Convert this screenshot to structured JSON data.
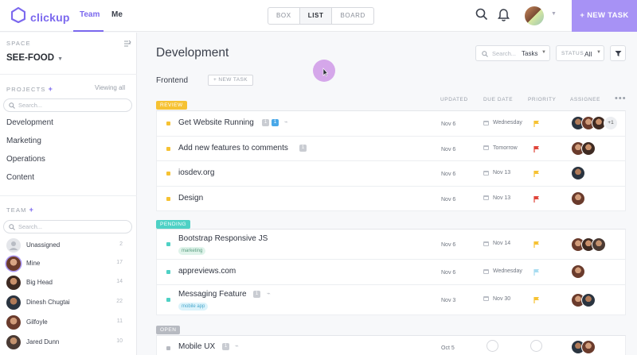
{
  "app": {
    "logo_text": "clickup",
    "brand_color": "#7b68ee"
  },
  "nav": {
    "team": "Team",
    "me": "Me"
  },
  "views": [
    "BOX",
    "LIST",
    "BOARD"
  ],
  "header": {
    "new_task": "+ NEW TASK"
  },
  "sidebar": {
    "space_label": "SPACE",
    "space_name": "SEE-FOOD",
    "projects_label": "PROJECTS",
    "viewing_all": "Viewing all",
    "search_placeholder": "Search...",
    "projects": [
      "Development",
      "Marketing",
      "Operations",
      "Content"
    ],
    "team_label": "TEAM",
    "team_search_placeholder": "Search...",
    "team": [
      {
        "name": "Unassigned",
        "count": "2"
      },
      {
        "name": "Mine",
        "count": "17"
      },
      {
        "name": "Big Head",
        "count": "14"
      },
      {
        "name": "Dinesh Chugtai",
        "count": "22"
      },
      {
        "name": "Gilfoyle",
        "count": "11"
      },
      {
        "name": "Jared Dunn",
        "count": "10"
      }
    ]
  },
  "main": {
    "title": "Development",
    "search_placeholder": "Search...",
    "search_scope": "Tasks",
    "status_label": "STATUS",
    "status_value": "All",
    "list_name": "Frontend",
    "new_task_small": "+ NEW TASK",
    "columns": {
      "updated": "UPDATED",
      "due": "DUE DATE",
      "priority": "PRIORITY",
      "assignee": "ASSIGNEE"
    }
  },
  "groups": [
    {
      "status": "REVIEW",
      "color": "#f6c233",
      "tasks": [
        {
          "name": "Get Website Running",
          "badge1": "1",
          "badge2": "1",
          "updated": "Nov 6",
          "due": "Wednesday",
          "flag": "#f6c233",
          "more": "+1"
        },
        {
          "name": "Add new features to comments",
          "badge1": "1",
          "updated": "Nov 6",
          "due": "Tomorrow",
          "flag": "#e0453a"
        },
        {
          "name": "iosdev.org",
          "updated": "Nov 6",
          "due": "Nov 13",
          "flag": "#f6c233"
        },
        {
          "name": "Design",
          "updated": "Nov 6",
          "due": "Nov 13",
          "flag": "#e0453a"
        }
      ]
    },
    {
      "status": "PENDING",
      "color": "#4fd1c5",
      "tasks": [
        {
          "name": "Bootstrap Responsive JS",
          "tag": "marketing",
          "updated": "Nov 6",
          "due": "Nov 14",
          "flag": "#f6c233"
        },
        {
          "name": "appreviews.com",
          "updated": "Nov 6",
          "due": "Wednesday",
          "flag": "#a8dcf0"
        },
        {
          "name": "Messaging Feature",
          "badge1": "1",
          "tag": "mobile app",
          "updated": "Nov 3",
          "due": "Nov 30",
          "flag": "#f6c233"
        }
      ]
    },
    {
      "status": "OPEN",
      "color": "#b7bac1",
      "tasks": [
        {
          "name": "Mobile UX",
          "badge1": "1",
          "updated": "Oct 5"
        }
      ]
    }
  ]
}
